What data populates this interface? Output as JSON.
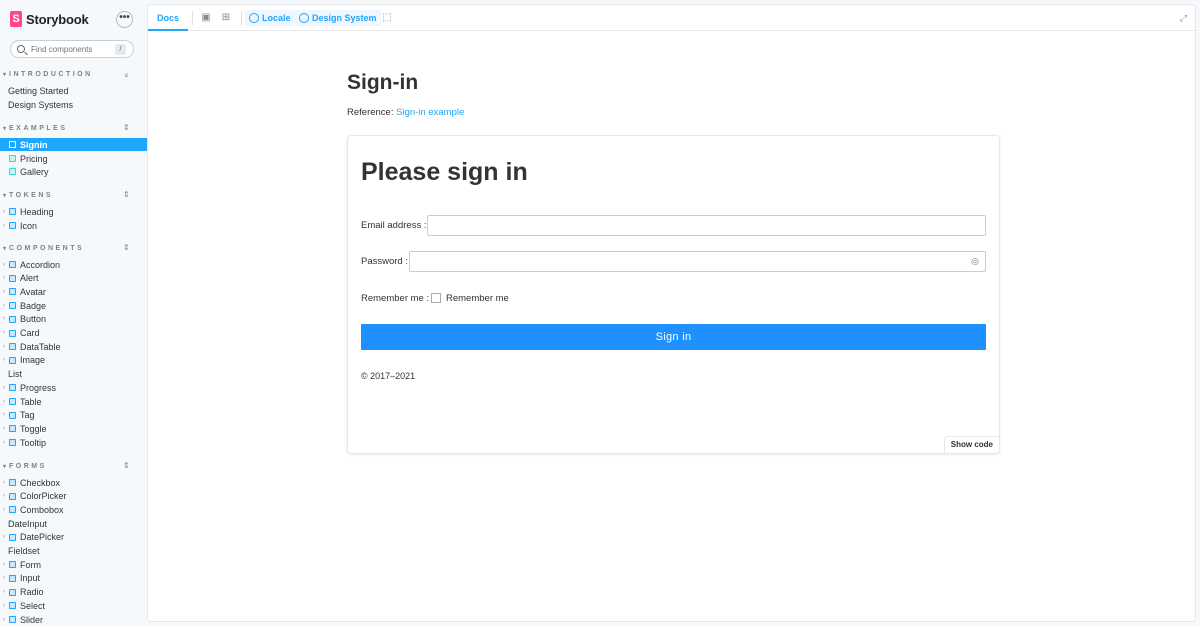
{
  "brand": {
    "name": "Storybook",
    "logo_letter": "S"
  },
  "sidebar": {
    "menu_label": "•••",
    "search": {
      "placeholder": "Find components",
      "shortcut": "/"
    },
    "sections": {
      "introduction": {
        "title": "INTRODUCTION",
        "toggle": "⌅",
        "items": [
          "Getting Started",
          "Design Systems"
        ]
      },
      "examples": {
        "title": "EXAMPLES",
        "toggle": "⇕",
        "items": [
          "Signin",
          "Pricing",
          "Gallery"
        ]
      },
      "tokens": {
        "title": "TOKENS",
        "toggle": "⇕",
        "items": [
          "Heading",
          "Icon"
        ]
      },
      "components": {
        "title": "COMPONENTS",
        "toggle": "⇕",
        "items": [
          "Accordion",
          "Alert",
          "Avatar",
          "Badge",
          "Button",
          "Card",
          "DataTable",
          "Image",
          "List",
          "Progress",
          "Table",
          "Tag",
          "Toggle",
          "Tooltip"
        ]
      },
      "forms": {
        "title": "FORMS",
        "toggle": "⇕",
        "items": [
          "Checkbox",
          "ColorPicker",
          "Combobox",
          "DateInput",
          "DatePicker",
          "Fieldset",
          "Form",
          "Input",
          "Radio",
          "Select",
          "Slider"
        ]
      }
    }
  },
  "toolbar": {
    "docs_tab": "Docs",
    "locale": "Locale",
    "design_system": "Design System"
  },
  "doc": {
    "title": "Sign-in",
    "reference_label": "Reference:",
    "reference_link": "Sign-in example"
  },
  "preview": {
    "heading": "Please sign in",
    "email_label": "Email address :",
    "password_label": "Password :",
    "remember_label": "Remember me :",
    "remember_checkbox_label": "Remember me",
    "submit": "Sign in",
    "copyright": "© 2017–2021",
    "show_code": "Show code"
  },
  "colors": {
    "accent": "#1ea7fd",
    "button": "#1e90ff",
    "brand": "#ff4785"
  }
}
